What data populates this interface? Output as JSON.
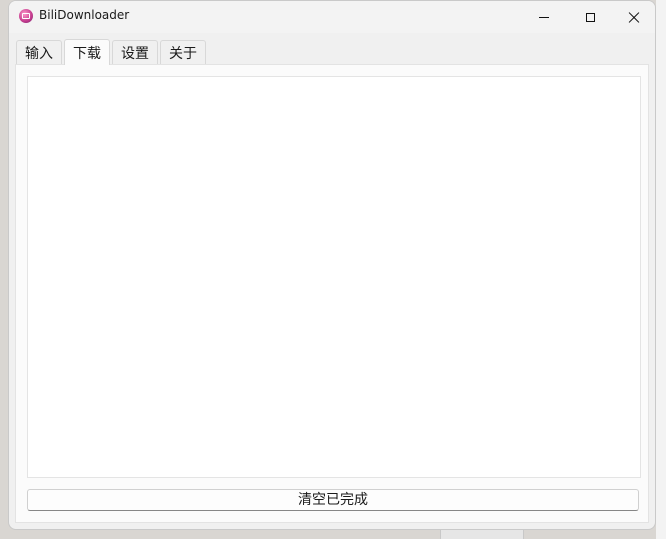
{
  "window": {
    "title": "BiliDownloader",
    "app_icon": "bilibili-downloader-icon",
    "controls": {
      "minimize": "minimize-icon",
      "maximize": "maximize-icon",
      "close": "close-icon"
    }
  },
  "tabs": [
    {
      "label": "输入",
      "active": false
    },
    {
      "label": "下载",
      "active": true
    },
    {
      "label": "设置",
      "active": false
    },
    {
      "label": "关于",
      "active": false
    }
  ],
  "download_panel": {
    "items": [],
    "clear_button_label": "清空已完成"
  }
}
